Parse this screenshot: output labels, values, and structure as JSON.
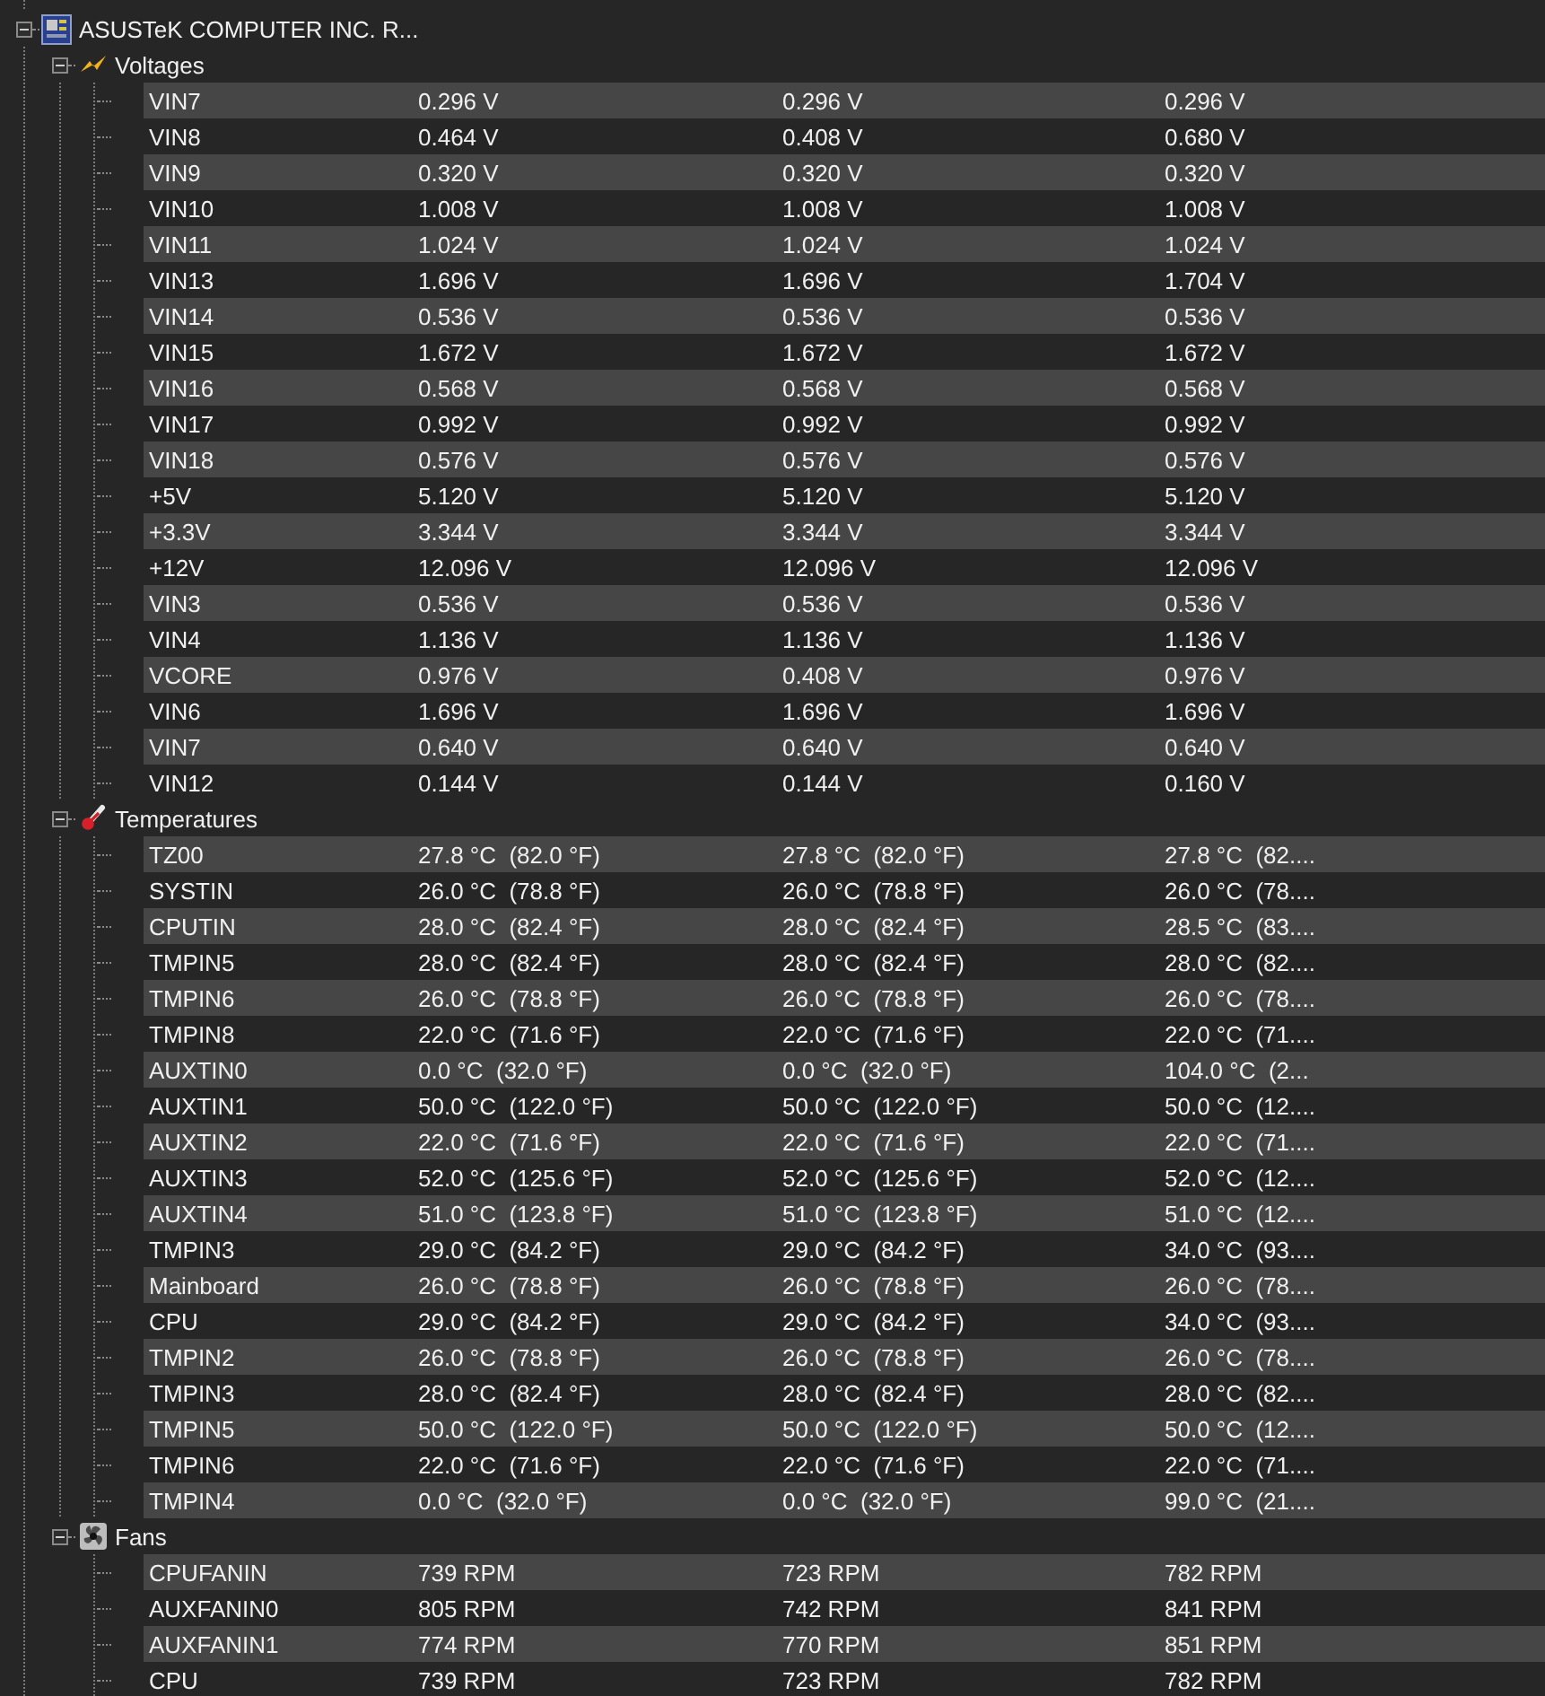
{
  "device": {
    "name": "ASUSTeK COMPUTER INC. R...",
    "expanded": true
  },
  "groups": [
    {
      "kind": "voltages",
      "label": "Voltages",
      "expanded": true,
      "rows": [
        {
          "name": "VIN7",
          "values": [
            "0.296 V",
            "0.296 V",
            "0.296 V"
          ]
        },
        {
          "name": "VIN8",
          "values": [
            "0.464 V",
            "0.408 V",
            "0.680 V"
          ]
        },
        {
          "name": "VIN9",
          "values": [
            "0.320 V",
            "0.320 V",
            "0.320 V"
          ]
        },
        {
          "name": "VIN10",
          "values": [
            "1.008 V",
            "1.008 V",
            "1.008 V"
          ]
        },
        {
          "name": "VIN11",
          "values": [
            "1.024 V",
            "1.024 V",
            "1.024 V"
          ]
        },
        {
          "name": "VIN13",
          "values": [
            "1.696 V",
            "1.696 V",
            "1.704 V"
          ]
        },
        {
          "name": "VIN14",
          "values": [
            "0.536 V",
            "0.536 V",
            "0.536 V"
          ]
        },
        {
          "name": "VIN15",
          "values": [
            "1.672 V",
            "1.672 V",
            "1.672 V"
          ]
        },
        {
          "name": "VIN16",
          "values": [
            "0.568 V",
            "0.568 V",
            "0.568 V"
          ]
        },
        {
          "name": "VIN17",
          "values": [
            "0.992 V",
            "0.992 V",
            "0.992 V"
          ]
        },
        {
          "name": "VIN18",
          "values": [
            "0.576 V",
            "0.576 V",
            "0.576 V"
          ]
        },
        {
          "name": "+5V",
          "values": [
            "5.120 V",
            "5.120 V",
            "5.120 V"
          ]
        },
        {
          "name": "+3.3V",
          "values": [
            "3.344 V",
            "3.344 V",
            "3.344 V"
          ]
        },
        {
          "name": "+12V",
          "values": [
            "12.096 V",
            "12.096 V",
            "12.096 V"
          ]
        },
        {
          "name": "VIN3",
          "values": [
            "0.536 V",
            "0.536 V",
            "0.536 V"
          ]
        },
        {
          "name": "VIN4",
          "values": [
            "1.136 V",
            "1.136 V",
            "1.136 V"
          ]
        },
        {
          "name": "VCORE",
          "values": [
            "0.976 V",
            "0.408 V",
            "0.976 V"
          ]
        },
        {
          "name": "VIN6",
          "values": [
            "1.696 V",
            "1.696 V",
            "1.696 V"
          ]
        },
        {
          "name": "VIN7",
          "values": [
            "0.640 V",
            "0.640 V",
            "0.640 V"
          ]
        },
        {
          "name": "VIN12",
          "values": [
            "0.144 V",
            "0.144 V",
            "0.160 V"
          ]
        }
      ]
    },
    {
      "kind": "temperatures",
      "label": "Temperatures",
      "expanded": true,
      "rows": [
        {
          "name": "TZ00",
          "values": [
            "27.8 °C  (82.0 °F)",
            "27.8 °C  (82.0 °F)",
            "27.8 °C  (82...."
          ]
        },
        {
          "name": "SYSTIN",
          "values": [
            "26.0 °C  (78.8 °F)",
            "26.0 °C  (78.8 °F)",
            "26.0 °C  (78...."
          ]
        },
        {
          "name": "CPUTIN",
          "values": [
            "28.0 °C  (82.4 °F)",
            "28.0 °C  (82.4 °F)",
            "28.5 °C  (83...."
          ]
        },
        {
          "name": "TMPIN5",
          "values": [
            "28.0 °C  (82.4 °F)",
            "28.0 °C  (82.4 °F)",
            "28.0 °C  (82...."
          ]
        },
        {
          "name": "TMPIN6",
          "values": [
            "26.0 °C  (78.8 °F)",
            "26.0 °C  (78.8 °F)",
            "26.0 °C  (78...."
          ]
        },
        {
          "name": "TMPIN8",
          "values": [
            "22.0 °C  (71.6 °F)",
            "22.0 °C  (71.6 °F)",
            "22.0 °C  (71...."
          ]
        },
        {
          "name": "AUXTIN0",
          "values": [
            "0.0 °C  (32.0 °F)",
            "0.0 °C  (32.0 °F)",
            "104.0 °C  (2..."
          ]
        },
        {
          "name": "AUXTIN1",
          "values": [
            "50.0 °C  (122.0 °F)",
            "50.0 °C  (122.0 °F)",
            "50.0 °C  (12...."
          ]
        },
        {
          "name": "AUXTIN2",
          "values": [
            "22.0 °C  (71.6 °F)",
            "22.0 °C  (71.6 °F)",
            "22.0 °C  (71...."
          ]
        },
        {
          "name": "AUXTIN3",
          "values": [
            "52.0 °C  (125.6 °F)",
            "52.0 °C  (125.6 °F)",
            "52.0 °C  (12...."
          ]
        },
        {
          "name": "AUXTIN4",
          "values": [
            "51.0 °C  (123.8 °F)",
            "51.0 °C  (123.8 °F)",
            "51.0 °C  (12...."
          ]
        },
        {
          "name": "TMPIN3",
          "values": [
            "29.0 °C  (84.2 °F)",
            "29.0 °C  (84.2 °F)",
            "34.0 °C  (93...."
          ]
        },
        {
          "name": "Mainboard",
          "values": [
            "26.0 °C  (78.8 °F)",
            "26.0 °C  (78.8 °F)",
            "26.0 °C  (78...."
          ]
        },
        {
          "name": "CPU",
          "values": [
            "29.0 °C  (84.2 °F)",
            "29.0 °C  (84.2 °F)",
            "34.0 °C  (93...."
          ]
        },
        {
          "name": "TMPIN2",
          "values": [
            "26.0 °C  (78.8 °F)",
            "26.0 °C  (78.8 °F)",
            "26.0 °C  (78...."
          ]
        },
        {
          "name": "TMPIN3",
          "values": [
            "28.0 °C  (82.4 °F)",
            "28.0 °C  (82.4 °F)",
            "28.0 °C  (82...."
          ]
        },
        {
          "name": "TMPIN5",
          "values": [
            "50.0 °C  (122.0 °F)",
            "50.0 °C  (122.0 °F)",
            "50.0 °C  (12...."
          ]
        },
        {
          "name": "TMPIN6",
          "values": [
            "22.0 °C  (71.6 °F)",
            "22.0 °C  (71.6 °F)",
            "22.0 °C  (71...."
          ]
        },
        {
          "name": "TMPIN4",
          "values": [
            "0.0 °C  (32.0 °F)",
            "0.0 °C  (32.0 °F)",
            "99.0 °C  (21...."
          ]
        }
      ]
    },
    {
      "kind": "fans",
      "label": "Fans",
      "expanded": true,
      "rows": [
        {
          "name": "CPUFANIN",
          "values": [
            "739 RPM",
            "723 RPM",
            "782 RPM"
          ]
        },
        {
          "name": "AUXFANIN0",
          "values": [
            "805 RPM",
            "742 RPM",
            "841 RPM"
          ]
        },
        {
          "name": "AUXFANIN1",
          "values": [
            "774 RPM",
            "770 RPM",
            "851 RPM"
          ]
        },
        {
          "name": "CPU",
          "values": [
            "739 RPM",
            "723 RPM",
            "782 RPM"
          ]
        }
      ]
    }
  ]
}
